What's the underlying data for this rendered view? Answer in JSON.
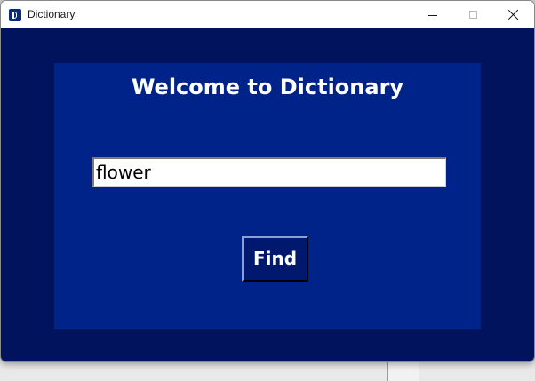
{
  "window": {
    "title": "Dictionary",
    "icon": "dictionary-app-icon",
    "controls": [
      "minimize",
      "maximize",
      "close"
    ]
  },
  "colors": {
    "client_background": "#00135c",
    "panel_background": "#00238a",
    "button_background": "#00196e",
    "text": "#ffffff"
  },
  "main": {
    "heading": "Welcome to Dictionary",
    "search": {
      "value": "flower",
      "placeholder": ""
    },
    "find_button_label": "Find"
  }
}
